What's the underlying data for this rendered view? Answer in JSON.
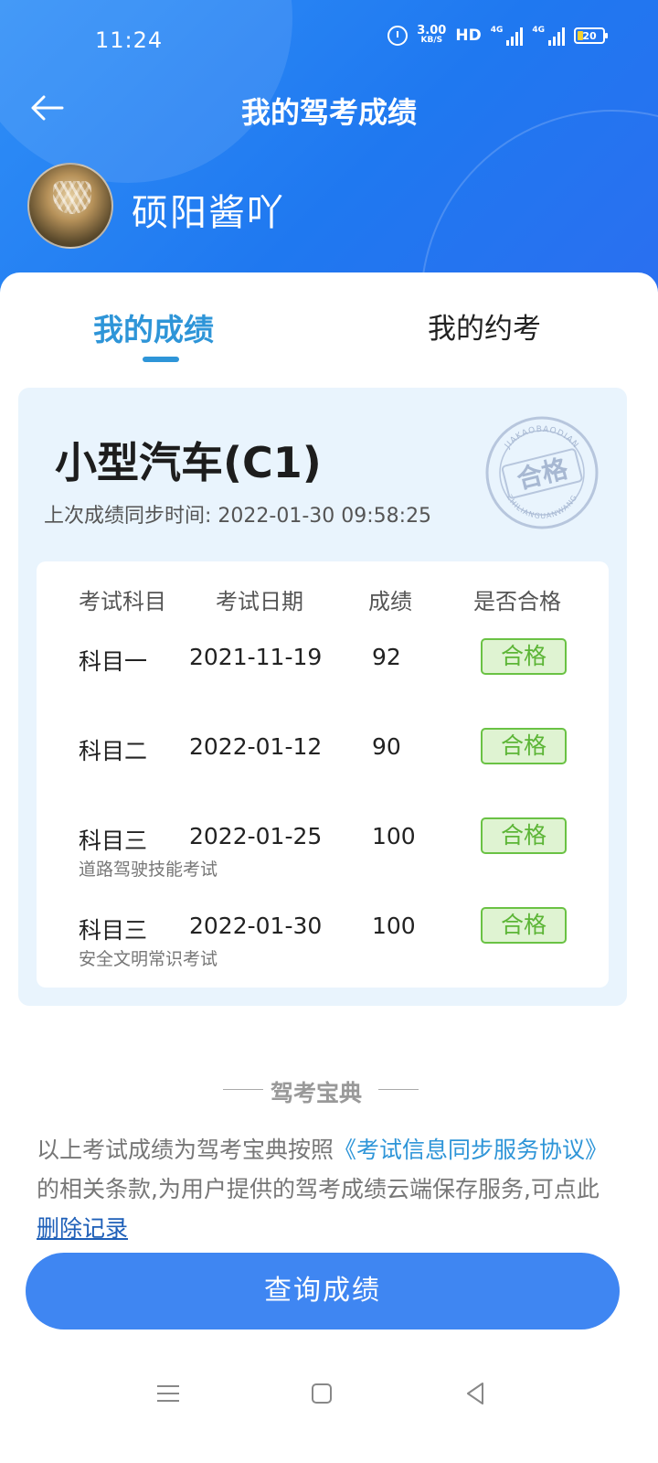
{
  "status_bar": {
    "time": "11:24",
    "speed_value": "3.00",
    "speed_unit": "KB/S",
    "hd_label": "HD",
    "net1": "4G",
    "net2": "4G",
    "battery": "20"
  },
  "header": {
    "title": "我的驾考成绩",
    "back_icon": "arrow-left-icon"
  },
  "profile": {
    "username": "硕阳酱吖"
  },
  "tabs": [
    {
      "label": "我的成绩",
      "active": true
    },
    {
      "label": "我的约考",
      "active": false
    }
  ],
  "license": {
    "type": "小型汽车(C1)",
    "sync_label": "上次成绩同步时间: 2022-01-30 09:58:25",
    "stamp_text": "合格",
    "stamp_top": "JIAKAOBAODIAN",
    "stamp_bottom": "ZHILIANGUANWANG"
  },
  "table": {
    "headers": [
      "考试科目",
      "考试日期",
      "成绩",
      "是否合格"
    ],
    "rows": [
      {
        "subject": "科目一",
        "date": "2021-11-19",
        "score": "92",
        "result": "合格",
        "note": ""
      },
      {
        "subject": "科目二",
        "date": "2022-01-12",
        "score": "90",
        "result": "合格",
        "note": ""
      },
      {
        "subject": "科目三",
        "date": "2022-01-25",
        "score": "100",
        "result": "合格",
        "note": "道路驾驶技能考试"
      },
      {
        "subject": "科目三",
        "date": "2022-01-30",
        "score": "100",
        "result": "合格",
        "note": "安全文明常识考试"
      }
    ]
  },
  "footer": {
    "brand": "驾考宝典",
    "disclaimer_part1": "以上考试成绩为驾考宝典按照",
    "disclaimer_link": "《考试信息同步服务协议》",
    "disclaimer_part2": "的相关条款,为用户提供的驾考成绩云端保存服务,可点此",
    "delete_link": "删除记录"
  },
  "query_button": {
    "label": "查询成绩"
  },
  "colors": {
    "primary": "#2f8ff7",
    "tab_active": "#2e95d8",
    "pass_green": "#5cb536",
    "button": "#3f86f2"
  }
}
